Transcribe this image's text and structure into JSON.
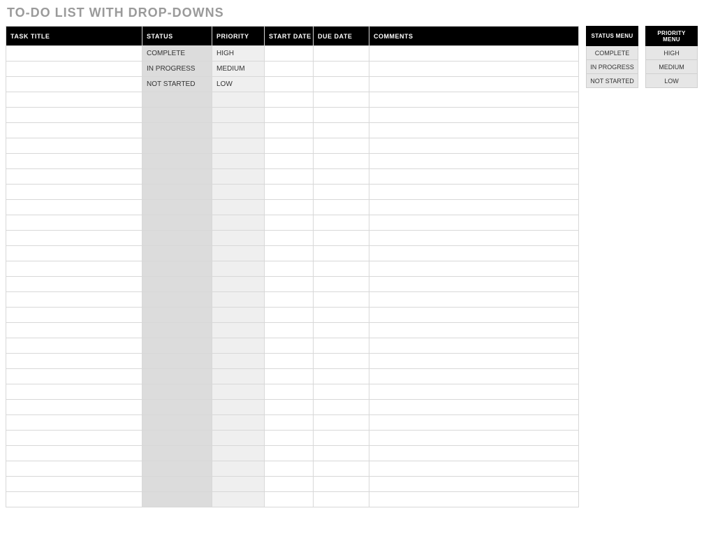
{
  "title": "TO-DO LIST WITH DROP-DOWNS",
  "columns": {
    "task": "TASK TITLE",
    "status": "STATUS",
    "priority": "PRIORITY",
    "start": "START DATE",
    "due": "DUE DATE",
    "comments": "COMMENTS"
  },
  "rows": [
    {
      "task": "",
      "status": "COMPLETE",
      "priority": "HIGH",
      "start": "",
      "due": "",
      "comments": ""
    },
    {
      "task": "",
      "status": "IN PROGRESS",
      "priority": "MEDIUM",
      "start": "",
      "due": "",
      "comments": ""
    },
    {
      "task": "",
      "status": "NOT STARTED",
      "priority": "LOW",
      "start": "",
      "due": "",
      "comments": ""
    },
    {
      "task": "",
      "status": "",
      "priority": "",
      "start": "",
      "due": "",
      "comments": ""
    },
    {
      "task": "",
      "status": "",
      "priority": "",
      "start": "",
      "due": "",
      "comments": ""
    },
    {
      "task": "",
      "status": "",
      "priority": "",
      "start": "",
      "due": "",
      "comments": ""
    },
    {
      "task": "",
      "status": "",
      "priority": "",
      "start": "",
      "due": "",
      "comments": ""
    },
    {
      "task": "",
      "status": "",
      "priority": "",
      "start": "",
      "due": "",
      "comments": ""
    },
    {
      "task": "",
      "status": "",
      "priority": "",
      "start": "",
      "due": "",
      "comments": ""
    },
    {
      "task": "",
      "status": "",
      "priority": "",
      "start": "",
      "due": "",
      "comments": ""
    },
    {
      "task": "",
      "status": "",
      "priority": "",
      "start": "",
      "due": "",
      "comments": ""
    },
    {
      "task": "",
      "status": "",
      "priority": "",
      "start": "",
      "due": "",
      "comments": ""
    },
    {
      "task": "",
      "status": "",
      "priority": "",
      "start": "",
      "due": "",
      "comments": ""
    },
    {
      "task": "",
      "status": "",
      "priority": "",
      "start": "",
      "due": "",
      "comments": ""
    },
    {
      "task": "",
      "status": "",
      "priority": "",
      "start": "",
      "due": "",
      "comments": ""
    },
    {
      "task": "",
      "status": "",
      "priority": "",
      "start": "",
      "due": "",
      "comments": ""
    },
    {
      "task": "",
      "status": "",
      "priority": "",
      "start": "",
      "due": "",
      "comments": ""
    },
    {
      "task": "",
      "status": "",
      "priority": "",
      "start": "",
      "due": "",
      "comments": ""
    },
    {
      "task": "",
      "status": "",
      "priority": "",
      "start": "",
      "due": "",
      "comments": ""
    },
    {
      "task": "",
      "status": "",
      "priority": "",
      "start": "",
      "due": "",
      "comments": ""
    },
    {
      "task": "",
      "status": "",
      "priority": "",
      "start": "",
      "due": "",
      "comments": ""
    },
    {
      "task": "",
      "status": "",
      "priority": "",
      "start": "",
      "due": "",
      "comments": ""
    },
    {
      "task": "",
      "status": "",
      "priority": "",
      "start": "",
      "due": "",
      "comments": ""
    },
    {
      "task": "",
      "status": "",
      "priority": "",
      "start": "",
      "due": "",
      "comments": ""
    },
    {
      "task": "",
      "status": "",
      "priority": "",
      "start": "",
      "due": "",
      "comments": ""
    },
    {
      "task": "",
      "status": "",
      "priority": "",
      "start": "",
      "due": "",
      "comments": ""
    },
    {
      "task": "",
      "status": "",
      "priority": "",
      "start": "",
      "due": "",
      "comments": ""
    },
    {
      "task": "",
      "status": "",
      "priority": "",
      "start": "",
      "due": "",
      "comments": ""
    },
    {
      "task": "",
      "status": "",
      "priority": "",
      "start": "",
      "due": "",
      "comments": ""
    },
    {
      "task": "",
      "status": "",
      "priority": "",
      "start": "",
      "due": "",
      "comments": ""
    }
  ],
  "status_menu": {
    "header": "STATUS MENU",
    "items": [
      "COMPLETE",
      "IN PROGRESS",
      "NOT STARTED"
    ]
  },
  "priority_menu": {
    "header": "PRIORITY MENU",
    "items": [
      "HIGH",
      "MEDIUM",
      "LOW"
    ]
  }
}
